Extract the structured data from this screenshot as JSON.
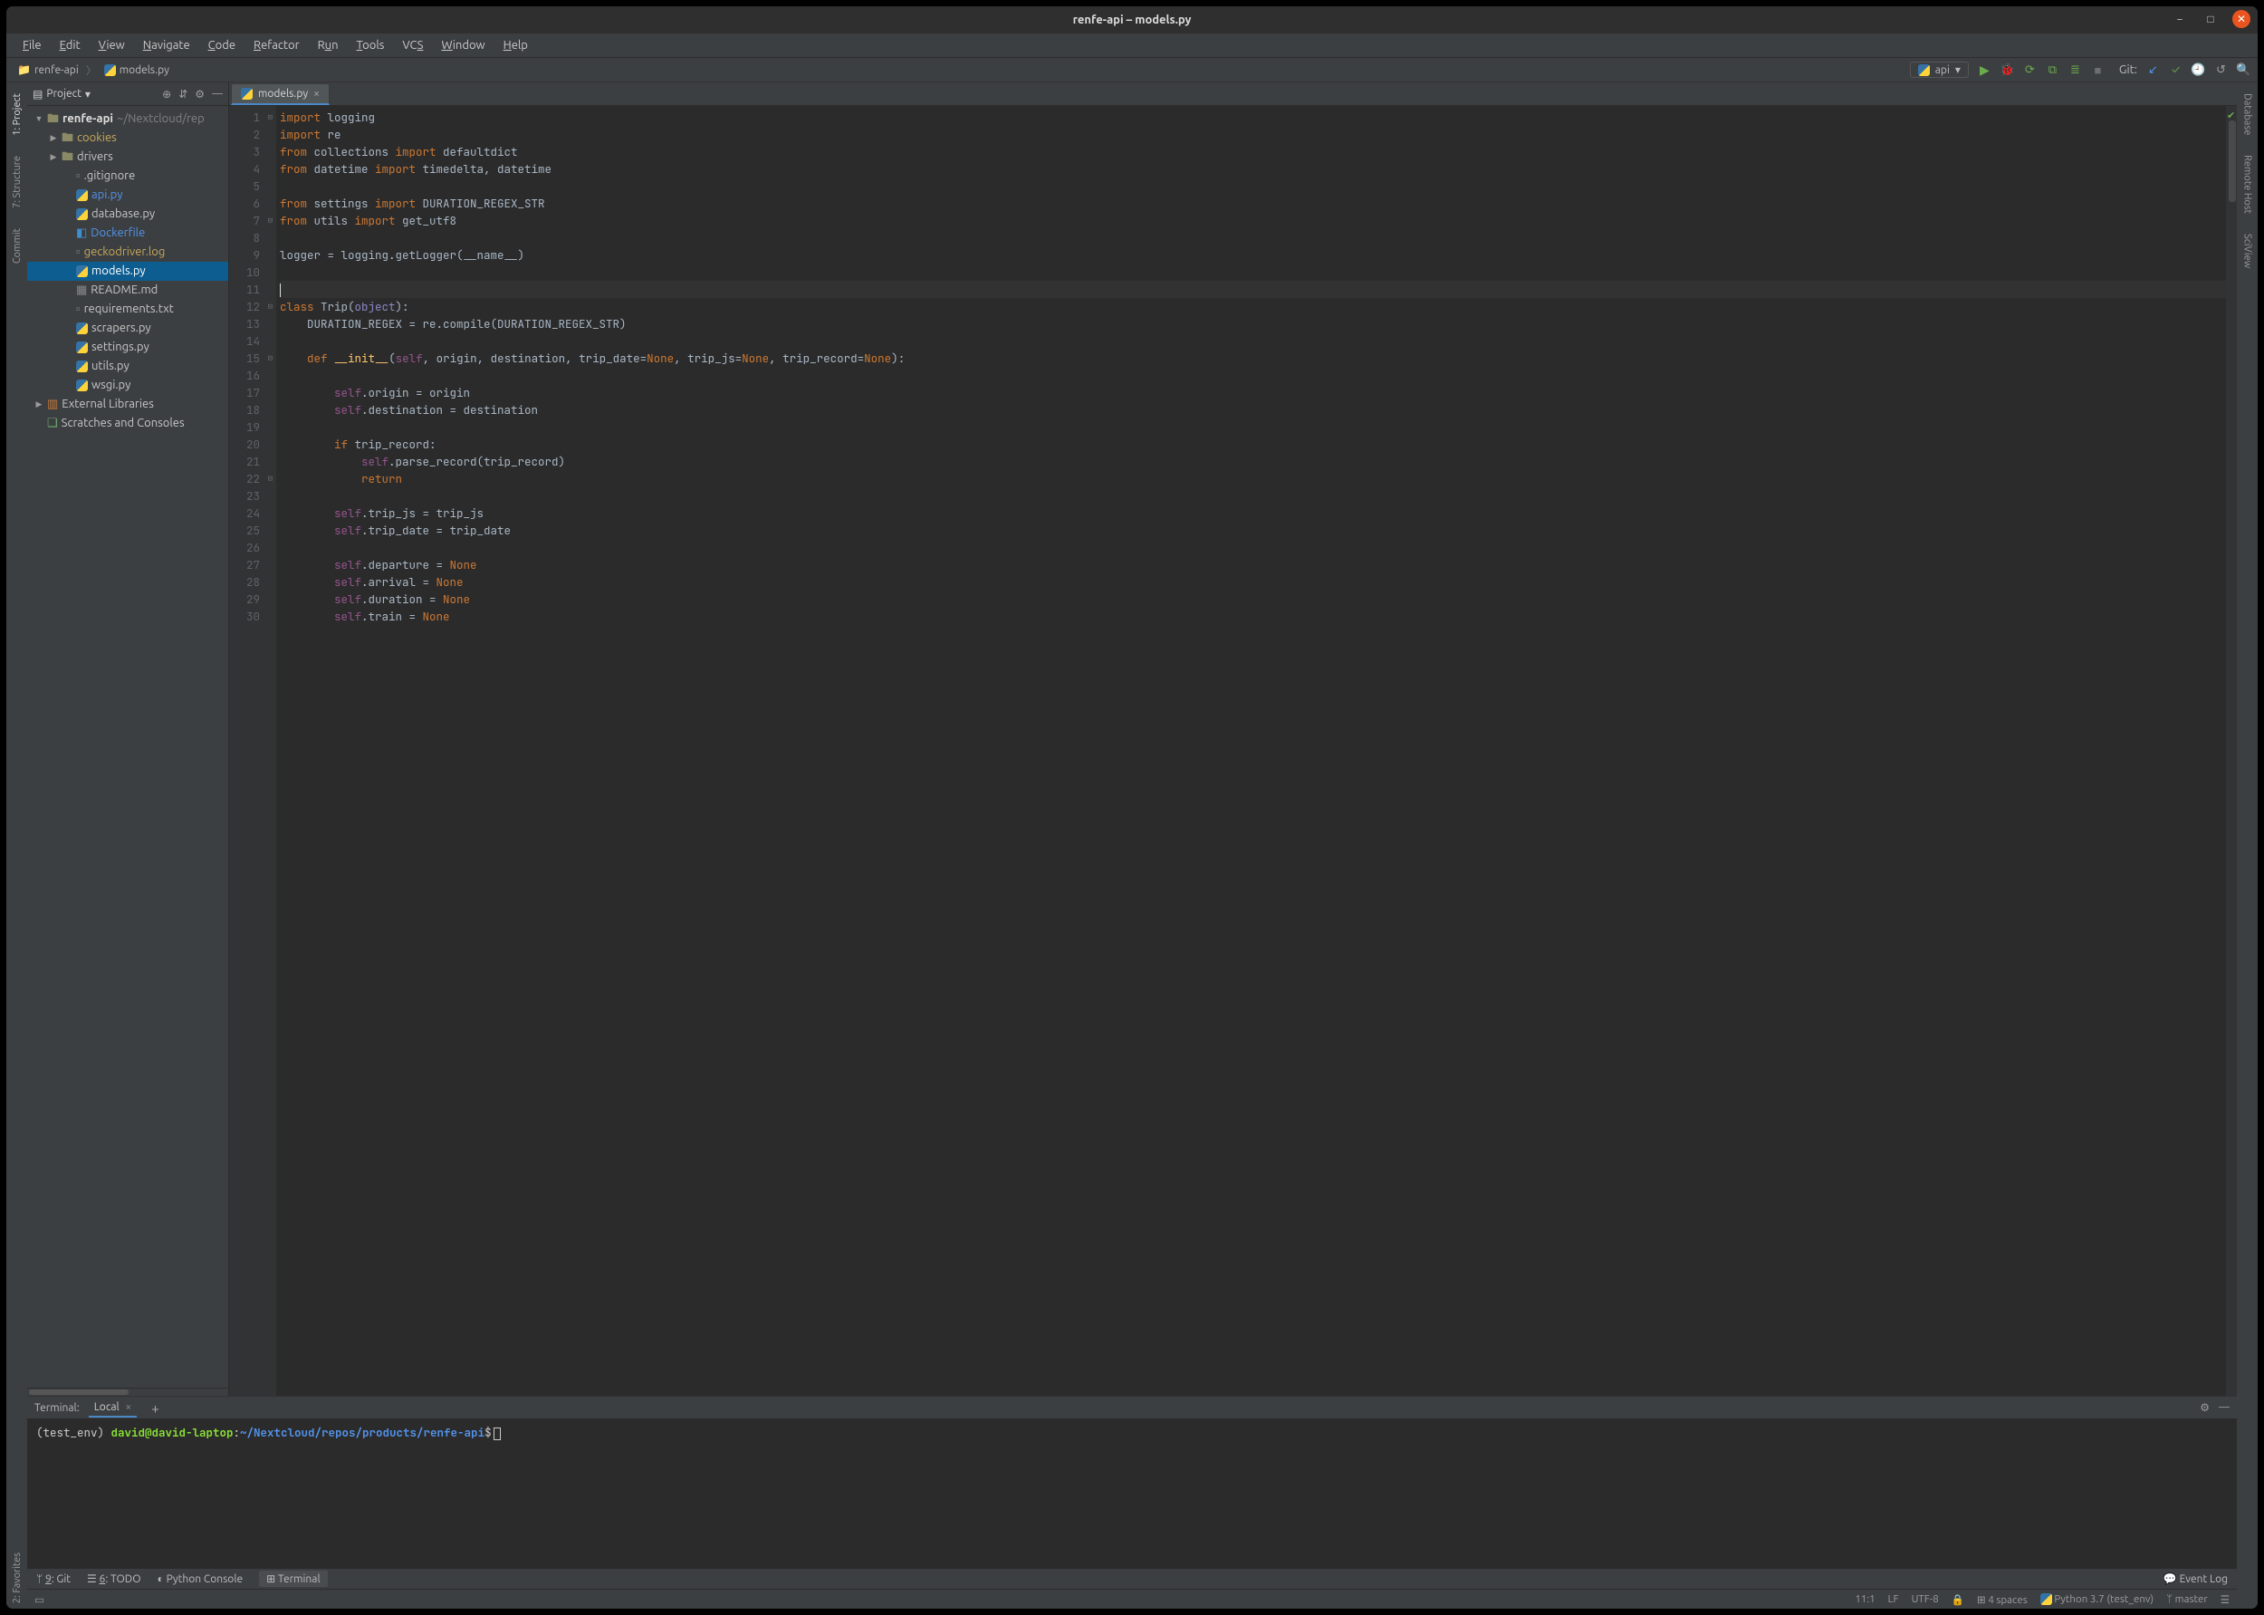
{
  "window": {
    "title": "renfe-api – models.py"
  },
  "menu": [
    "File",
    "Edit",
    "View",
    "Navigate",
    "Code",
    "Refactor",
    "Run",
    "Tools",
    "VCS",
    "Window",
    "Help"
  ],
  "menu_underlines": [
    "F",
    "E",
    "V",
    "N",
    "C",
    "R",
    "u",
    "T",
    "S",
    "W",
    "H"
  ],
  "breadcrumbs": [
    {
      "icon": "folder",
      "label": "renfe-api"
    },
    {
      "icon": "py",
      "label": "models.py"
    }
  ],
  "run_config": {
    "label": "api"
  },
  "toolbar_right": {
    "git_label": "Git:"
  },
  "left_tool_tabs": [
    {
      "label": "1: Project",
      "active": true
    },
    {
      "label": "7: Structure"
    },
    {
      "label": "Commit"
    },
    {
      "label": "2: Favorites"
    }
  ],
  "right_tool_tabs": [
    {
      "label": "Database"
    },
    {
      "label": "Remote Host"
    },
    {
      "label": "SciView"
    }
  ],
  "project_pane": {
    "title": "Project",
    "tree": [
      {
        "depth": 0,
        "arrow": "▼",
        "icon": "folder",
        "label": "renfe-api",
        "suffix": "~/Nextcloud/rep",
        "bold": true
      },
      {
        "depth": 1,
        "arrow": "▶",
        "icon": "folder",
        "label": "cookies",
        "class": "gold"
      },
      {
        "depth": 1,
        "arrow": "▶",
        "icon": "folder",
        "label": "drivers"
      },
      {
        "depth": 2,
        "icon": "file",
        "label": ".gitignore"
      },
      {
        "depth": 2,
        "icon": "py",
        "label": "api.py",
        "class": "blue"
      },
      {
        "depth": 2,
        "icon": "py",
        "label": "database.py"
      },
      {
        "depth": 2,
        "icon": "docker",
        "label": "Dockerfile",
        "class": "blue"
      },
      {
        "depth": 2,
        "icon": "file",
        "label": "geckodriver.log",
        "class": "gold"
      },
      {
        "depth": 2,
        "icon": "py",
        "label": "models.py",
        "selected": true
      },
      {
        "depth": 2,
        "icon": "md",
        "label": "README.md"
      },
      {
        "depth": 2,
        "icon": "file",
        "label": "requirements.txt"
      },
      {
        "depth": 2,
        "icon": "py",
        "label": "scrapers.py"
      },
      {
        "depth": 2,
        "icon": "py",
        "label": "settings.py"
      },
      {
        "depth": 2,
        "icon": "py",
        "label": "utils.py"
      },
      {
        "depth": 2,
        "icon": "py",
        "label": "wsgi.py"
      },
      {
        "depth": 0,
        "arrow": "▶",
        "icon": "libs",
        "label": "External Libraries"
      },
      {
        "depth": 0,
        "icon": "scratch",
        "label": "Scratches and Consoles"
      }
    ]
  },
  "editor": {
    "tab_label": "models.py",
    "lines": [
      {
        "n": 1,
        "fold": "⊖",
        "html": "<span class='kw'>import</span> logging"
      },
      {
        "n": 2,
        "html": "<span class='kw'>import</span> re"
      },
      {
        "n": 3,
        "html": "<span class='kw'>from</span> collections <span class='kw'>import</span> defaultdict"
      },
      {
        "n": 4,
        "html": "<span class='kw'>from</span> datetime <span class='kw'>import</span> timedelta, datetime"
      },
      {
        "n": 5,
        "html": ""
      },
      {
        "n": 6,
        "html": "<span class='kw'>from</span> settings <span class='kw'>import</span> DURATION_REGEX_STR"
      },
      {
        "n": 7,
        "fold": "⊖",
        "html": "<span class='kw'>from</span> utils <span class='kw'>import</span> get_utf8"
      },
      {
        "n": 8,
        "html": ""
      },
      {
        "n": 9,
        "html": "logger = logging.getLogger(__name__)"
      },
      {
        "n": 10,
        "html": ""
      },
      {
        "n": 11,
        "caret": true,
        "html": "<span class='caret'></span>"
      },
      {
        "n": 12,
        "fold": "⊖",
        "html": "<span class='kw'>class</span> Trip(<span class='builtin'>object</span>):"
      },
      {
        "n": 13,
        "html": "    DURATION_REGEX = re.compile(DURATION_REGEX_STR)"
      },
      {
        "n": 14,
        "html": ""
      },
      {
        "n": 15,
        "fold": "⊖",
        "html": "    <span class='kw'>def</span> <span class='fn'>__init__</span>(<span class='self'>self</span>, origin, destination, trip_date=<span class='kw'>None</span>, trip_js=<span class='kw'>None</span>, trip_record=<span class='kw'>None</span>):"
      },
      {
        "n": 16,
        "html": ""
      },
      {
        "n": 17,
        "html": "        <span class='self'>self</span>.origin = origin"
      },
      {
        "n": 18,
        "html": "        <span class='self'>self</span>.destination = destination"
      },
      {
        "n": 19,
        "html": ""
      },
      {
        "n": 20,
        "html": "        <span class='kw'>if</span> trip_record:"
      },
      {
        "n": 21,
        "html": "            <span class='self'>self</span>.parse_record(trip_record)"
      },
      {
        "n": 22,
        "fold": "⊖",
        "html": "            <span class='kw'>return</span>"
      },
      {
        "n": 23,
        "html": ""
      },
      {
        "n": 24,
        "html": "        <span class='self'>self</span>.trip_js = trip_js"
      },
      {
        "n": 25,
        "html": "        <span class='self'>self</span>.trip_date = trip_date"
      },
      {
        "n": 26,
        "html": ""
      },
      {
        "n": 27,
        "html": "        <span class='self'>self</span>.departure = <span class='kw'>None</span>"
      },
      {
        "n": 28,
        "html": "        <span class='self'>self</span>.arrival = <span class='kw'>None</span>"
      },
      {
        "n": 29,
        "html": "        <span class='self'>self</span>.duration = <span class='kw'>None</span>"
      },
      {
        "n": 30,
        "html": "        <span class='self'>self</span>.train = <span class='kw'>None</span>"
      }
    ]
  },
  "terminal": {
    "title": "Terminal:",
    "tab": "Local",
    "prompt_env": "(test_env) ",
    "prompt_user": "david@david-laptop",
    "prompt_sep": ":",
    "prompt_path": "~/Nextcloud/repos/products/renfe-api",
    "prompt_end": "$"
  },
  "bottom_tools": [
    {
      "label": "9: Git",
      "icon": "branch"
    },
    {
      "label": "6: TODO",
      "icon": "list"
    },
    {
      "label": "Python Console",
      "icon": "py"
    },
    {
      "label": "Terminal",
      "icon": "term",
      "active": true
    }
  ],
  "event_log": "Event Log",
  "status": {
    "pos": "11:1",
    "le": "LF",
    "enc": "UTF-8",
    "lock": "🔒",
    "indent": "4 spaces",
    "python": "Python 3.7 (test_env)",
    "branch": "master"
  }
}
